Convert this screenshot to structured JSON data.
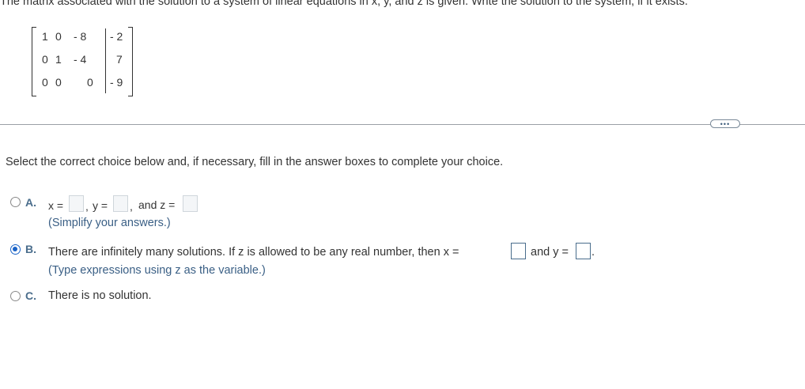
{
  "question": {
    "prompt": "The matrix associated with the solution to a system of linear equations in x, y, and z is given. Write the solution to the system, if it exists.",
    "matrix": {
      "rows": [
        [
          "1",
          "0",
          "- 8",
          "- 2"
        ],
        [
          "0",
          "1",
          "- 4",
          "7"
        ],
        [
          "0",
          "0",
          "0",
          "- 9"
        ]
      ]
    },
    "more_button_label": "•••",
    "instruction": "Select the correct choice below and, if necessary, fill in the answer boxes to complete your choice."
  },
  "choices": {
    "a": {
      "letter": "A.",
      "x_label": "x =",
      "comma1": ",",
      "y_label": "y =",
      "comma2": ",",
      "and_z_label": "and z =",
      "hint": "(Simplify your answers.)",
      "selected": false
    },
    "b": {
      "letter": "B.",
      "text": "There are infinitely many solutions. If z is allowed to be any real number, then x =",
      "and_y_label": "and y =",
      "period": ".",
      "hint": "(Type expressions using z as the variable.)",
      "selected": true
    },
    "c": {
      "letter": "C.",
      "text": "There is no solution.",
      "selected": false
    }
  }
}
